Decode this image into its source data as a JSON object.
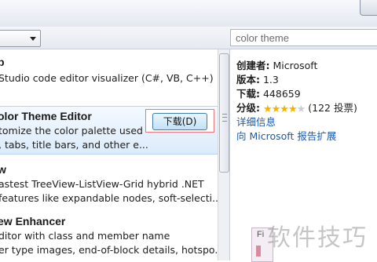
{
  "search": {
    "value": "color theme"
  },
  "list": {
    "items": [
      {
        "title": "p",
        "desc": [
          "Studio code editor visualizer (C#, VB, C++)"
        ]
      },
      {
        "title": "olor Theme Editor",
        "desc": [
          "tomize the color palette used",
          ", tabs, title bars, and other e..."
        ],
        "selected": true
      },
      {
        "title": "w",
        "desc": [
          "astest TreeView-ListView-Grid hybrid .NET",
          "features like expandable nodes, soft-selecti..."
        ]
      },
      {
        "title": "ew Enhancer",
        "desc": [
          "ditor with class and member name",
          "er type images, end-of-block details, hotspo..."
        ]
      }
    ],
    "download_label": "下载(D)"
  },
  "details": {
    "creator_label": "创建者:",
    "creator_value": "Microsoft",
    "version_label": "版本:",
    "version_value": "1.3",
    "downloads_label": "下载:",
    "downloads_value": "448659",
    "rating_label": "分级:",
    "rating_value": 4.5,
    "rating_max": 5,
    "rating_votes": "(122 投票)",
    "more_info_link": "详细信息",
    "report_link": "向 Microsoft 报告扩展"
  },
  "preview": {
    "label": "Fi"
  },
  "watermark": "软件技巧",
  "colors": {
    "link": "#1e5aa8",
    "star": "#f2b400",
    "download_border": "#e6787f"
  }
}
